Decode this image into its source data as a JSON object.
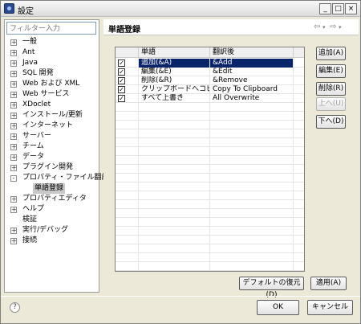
{
  "window": {
    "title": "設定",
    "minimize": "_",
    "maximize": "□",
    "close": "×"
  },
  "left": {
    "filter_placeholder": "フィルター入力",
    "tree": [
      {
        "label": "一般",
        "twisty": "+"
      },
      {
        "label": "Ant",
        "twisty": "+"
      },
      {
        "label": "Java",
        "twisty": "+"
      },
      {
        "label": "SQL 開発",
        "twisty": "+"
      },
      {
        "label": "Web および XML",
        "twisty": "+"
      },
      {
        "label": "Web サービス",
        "twisty": "+"
      },
      {
        "label": "XDoclet",
        "twisty": "+"
      },
      {
        "label": "インストール/更新",
        "twisty": "+"
      },
      {
        "label": "インターネット",
        "twisty": "+"
      },
      {
        "label": "サーバー",
        "twisty": "+"
      },
      {
        "label": "チーム",
        "twisty": "+"
      },
      {
        "label": "データ",
        "twisty": "+"
      },
      {
        "label": "プラグイン開発",
        "twisty": "+"
      },
      {
        "label": "プロパティ・ファイル翻訳",
        "twisty": "-"
      },
      {
        "label": "単語登録",
        "twisty": ""
      },
      {
        "label": "プロパティエディタ",
        "twisty": "+"
      },
      {
        "label": "ヘルプ",
        "twisty": "+"
      },
      {
        "label": "検証",
        "twisty": ""
      },
      {
        "label": "実行/デバッグ",
        "twisty": "+"
      },
      {
        "label": "接続",
        "twisty": "+"
      }
    ]
  },
  "right": {
    "title": "単語登録",
    "nav_back": "⇦",
    "nav_back_dd": "▾",
    "nav_fwd": "⇨",
    "nav_fwd_dd": "▾",
    "table": {
      "columns": [
        "",
        "単語",
        "翻訳後"
      ],
      "rows": [
        {
          "checked": "✓",
          "word": "追加(&A)",
          "translation": "&Add"
        },
        {
          "checked": "✓",
          "word": "編集(&E)",
          "translation": "&Edit"
        },
        {
          "checked": "✓",
          "word": "削除(&R)",
          "translation": "&Remove"
        },
        {
          "checked": "✓",
          "word": "クリップボードへコピー",
          "translation": "Copy To Clipboard"
        },
        {
          "checked": "✓",
          "word": "すべて上書き",
          "translation": "All Overwrite"
        }
      ]
    },
    "buttons": {
      "add": "追加(A)",
      "edit": "編集(E)",
      "delete": "削除(R)",
      "up": "上へ(U)",
      "down": "下へ(D)",
      "restore_defaults": "デフォルトの復元(D)",
      "apply": "適用(A)"
    }
  },
  "footer": {
    "help": "?",
    "ok": "OK",
    "cancel": "キャンセル"
  }
}
